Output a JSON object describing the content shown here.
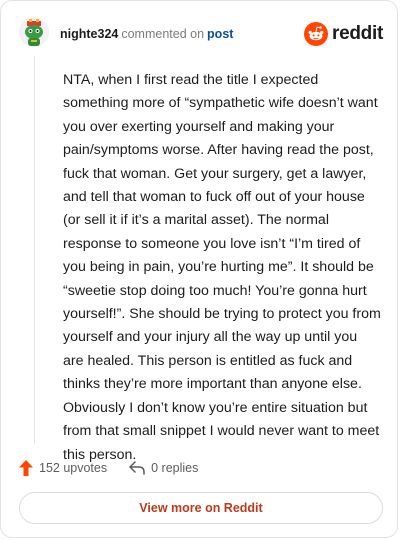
{
  "comment": {
    "username": "nighte324",
    "action_text": "commented on",
    "post_link": "post",
    "body": "NTA, when I first read the title I expected something more of “sympathetic wife doesn’t want you over exerting yourself and making your pain/symptoms worse. After having read the post, fuck that woman. Get your surgery, get a lawyer, and tell that woman to fuck off out of your house (or sell it if it’s a marital asset). The normal response to someone you love isn’t “I’m tired of you being in pain, you’re hurting me”. It should be “sweetie stop doing too much! You’re gonna hurt yourself!”. She should be trying to protect you from yourself and your injury all the way up until you are healed. This person is entitled as fuck and thinks they’re more important than anyone else. Obviously I don’t know you’re entire situation but from that small snippet I would never want to meet this person."
  },
  "brand": {
    "name": "reddit",
    "icon": "reddit-logo-icon",
    "color": "#ff4500"
  },
  "avatar": {
    "icon": "snoo-avatar-icon",
    "color": "#2e8b3a"
  },
  "actions": {
    "upvotes_label": "152 upvotes",
    "upvote_icon": "upvote-arrow-icon",
    "upvote_color": "#ff4500",
    "replies_label": "0 replies",
    "reply_icon": "reply-arrow-icon"
  },
  "footer": {
    "view_more_label": "View more on Reddit",
    "accent": "#c0391b"
  }
}
